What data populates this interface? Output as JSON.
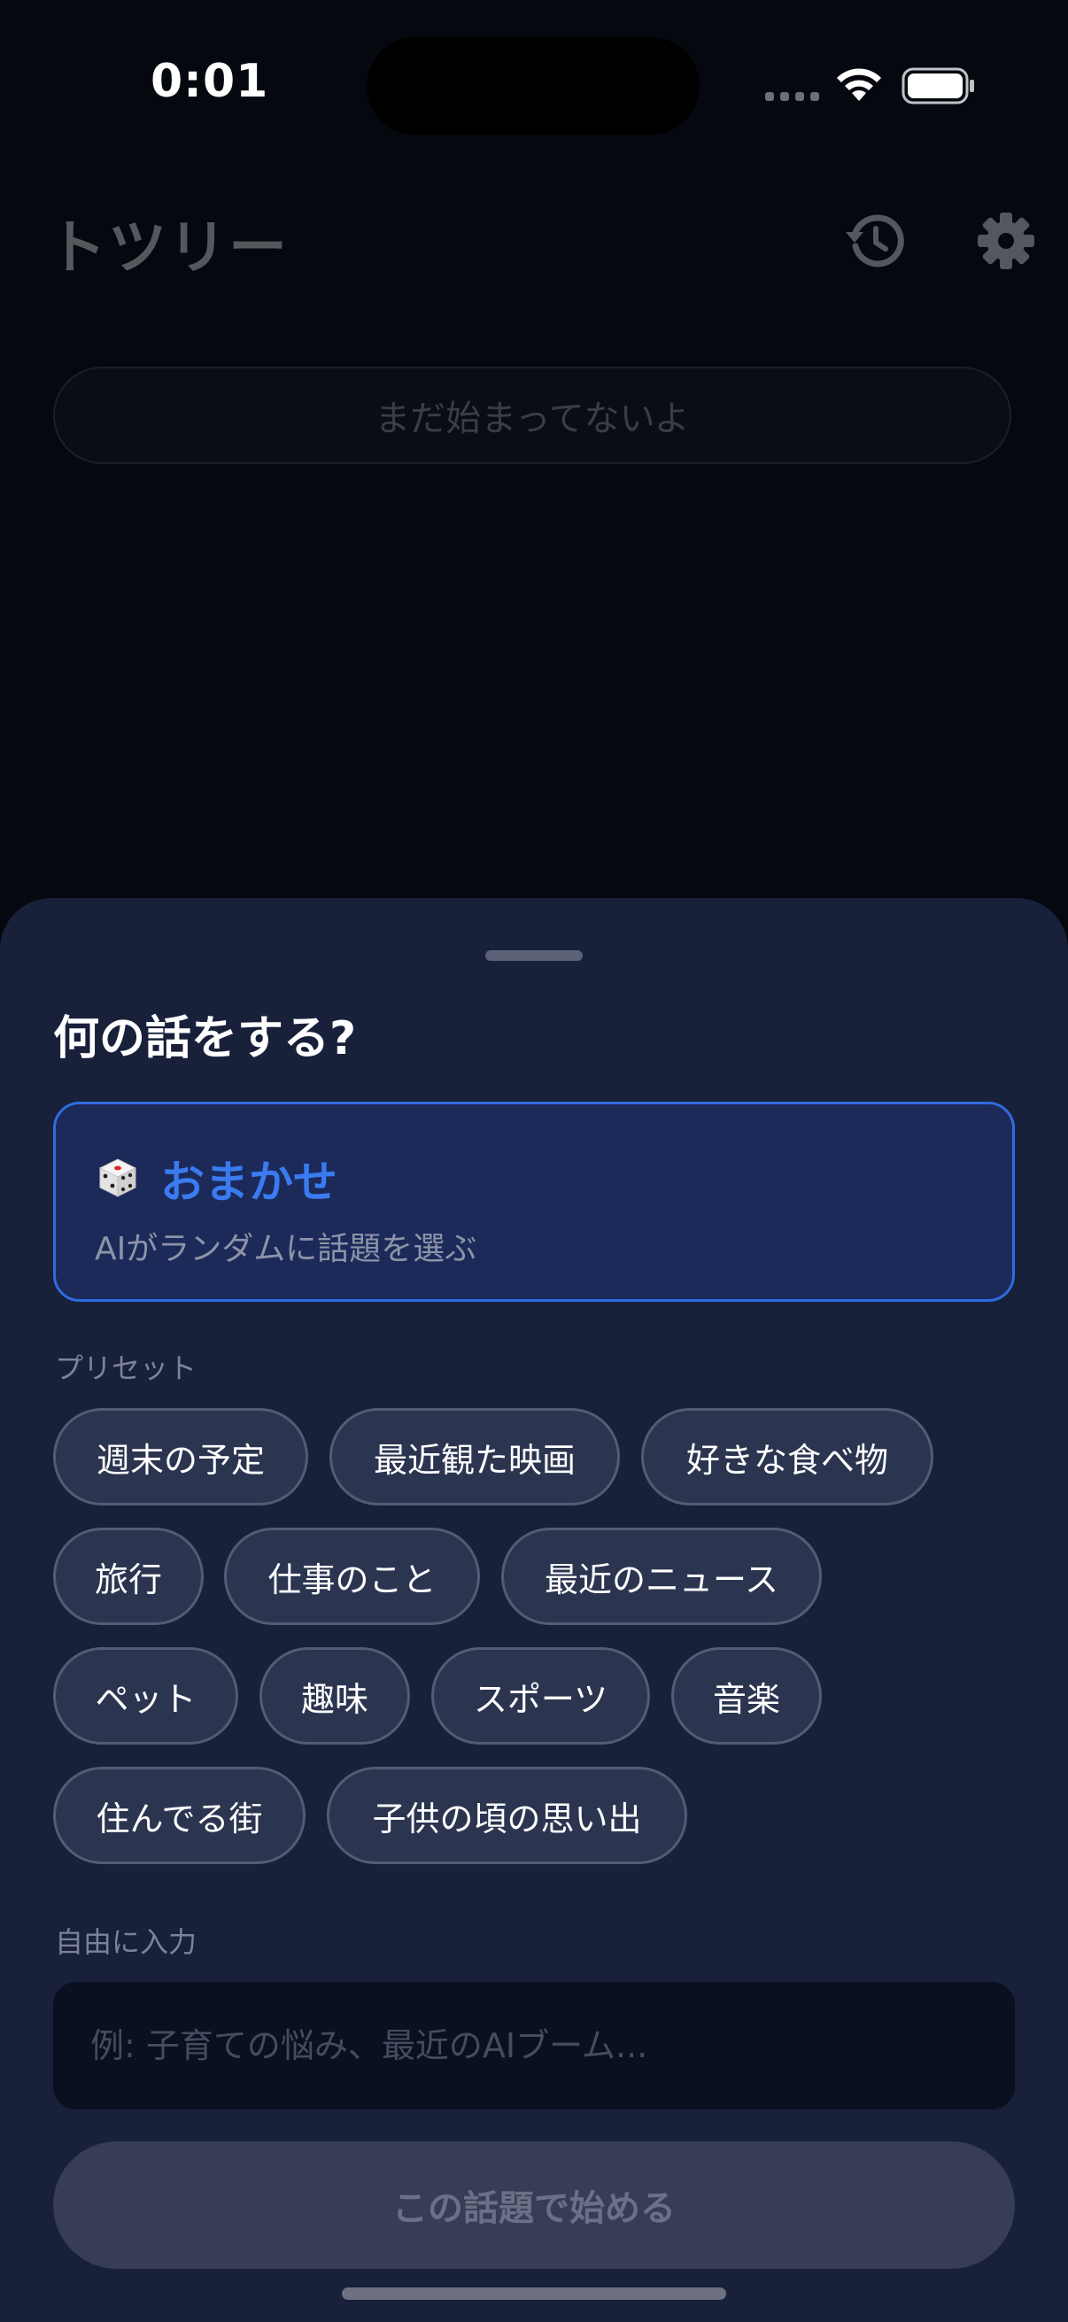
{
  "status_bar": {
    "time": "0:01"
  },
  "app": {
    "title": "トツリー",
    "status_text": "まだ始まってないよ",
    "icons": [
      "history-icon",
      "gear-icon"
    ]
  },
  "sheet": {
    "title": "何の話をする?",
    "random_option": {
      "icon": "dice-icon",
      "title": "おまかせ",
      "subtitle": "AIがランダムに話題を選ぶ"
    },
    "preset_label": "プリセット",
    "presets": [
      "週末の予定",
      "最近観た映画",
      "好きな食べ物",
      "旅行",
      "仕事のこと",
      "最近のニュース",
      "ペット",
      "趣味",
      "スポーツ",
      "音楽",
      "住んでる街",
      "子供の頃の思い出"
    ],
    "free_input_label": "自由に入力",
    "free_input_placeholder": "例: 子育ての悩み、最近のAIブーム...",
    "free_input_value": "",
    "start_button": "この話題で始める"
  },
  "colors": {
    "sheet_background": "#18203a",
    "accent": "#3a7bf0",
    "chip_background": "#2c3550",
    "button_disabled": "#363d55"
  }
}
